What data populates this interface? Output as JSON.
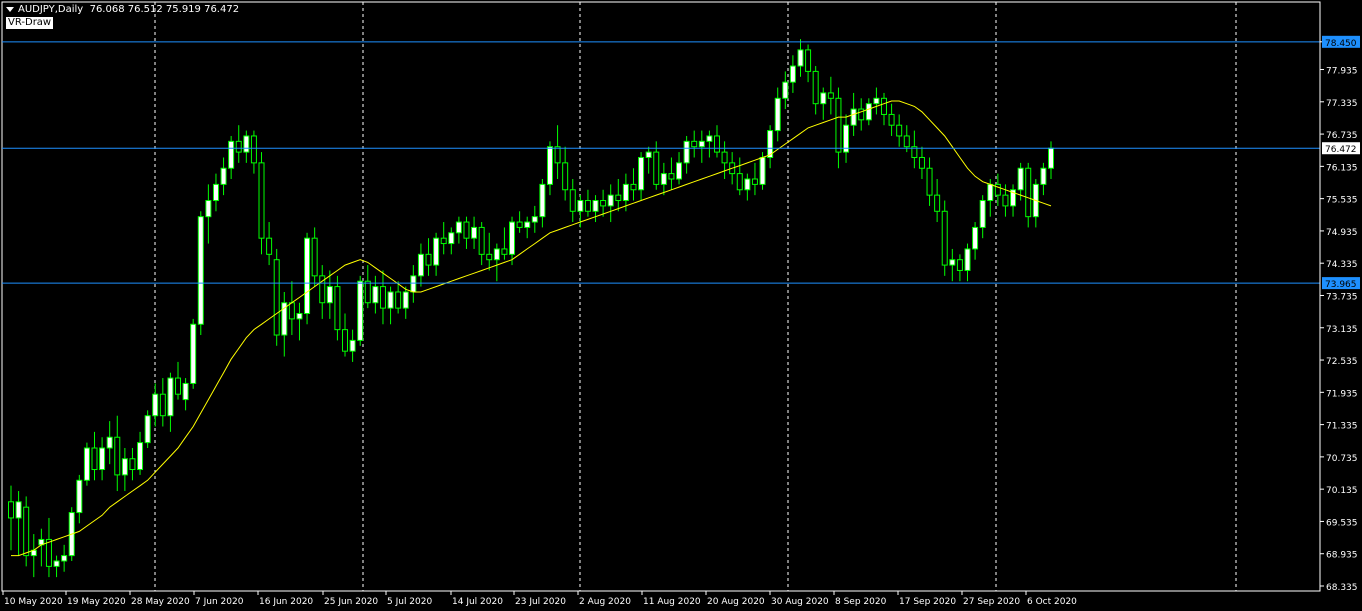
{
  "header": {
    "symbol_timeframe": "AUDJPY,Daily",
    "ohlc": "76.068 76.512 75.919 76.472",
    "indicator_label": "VR-Draw"
  },
  "colors": {
    "background": "#000000",
    "bull_candle": "#ffffff",
    "bear_candle": "#000000",
    "candle_outline": "#00ff00",
    "ma_line": "#ffff00",
    "hline": "#1e90ff",
    "price_tag": "#1e90ff",
    "current_price_tag": "#ffffff",
    "grid_vline": "#ffffff",
    "axis_text": "#ffffff"
  },
  "chart_data": {
    "type": "candlestick",
    "y_ticks": [
      "78.450",
      "77.935",
      "77.335",
      "76.735",
      "76.135",
      "75.535",
      "74.935",
      "74.335",
      "73.735",
      "73.135",
      "72.535",
      "71.935",
      "71.335",
      "70.735",
      "70.135",
      "69.535",
      "68.935",
      "68.335"
    ],
    "ylim": [
      68.335,
      78.85
    ],
    "x_tick_labels": [
      "10 May 2020",
      "19 May 2020",
      "28 May 2020",
      "7 Jun 2020",
      "16 Jun 2020",
      "25 Jun 2020",
      "5 Jul 2020",
      "14 Jul 2020",
      "23 Jul 2020",
      "2 Aug 2020",
      "11 Aug 2020",
      "20 Aug 2020",
      "30 Aug 2020",
      "8 Sep 2020",
      "17 Sep 2020",
      "27 Sep 2020",
      "6 Oct 2020"
    ],
    "period_separators": [
      "1 Jun 2020",
      "1 Jul 2020",
      "1 Aug 2020",
      "1 Sep 2020",
      "1 Oct 2020",
      "1 Nov 2020"
    ],
    "horizontal_lines": [
      {
        "price": 78.45,
        "label": "78.450"
      },
      {
        "price": 76.472,
        "label": "76.472",
        "current": true
      },
      {
        "price": 73.965,
        "label": "73.965"
      }
    ],
    "ohlc": [
      [
        69.9,
        70.2,
        69.0,
        69.6
      ],
      [
        69.6,
        70.1,
        68.9,
        69.9
      ],
      [
        69.8,
        70.0,
        68.7,
        68.9
      ],
      [
        68.9,
        69.3,
        68.5,
        69.0
      ],
      [
        69.1,
        69.4,
        68.7,
        69.2
      ],
      [
        69.2,
        69.6,
        68.5,
        68.7
      ],
      [
        68.7,
        68.9,
        68.5,
        68.8
      ],
      [
        68.8,
        69.1,
        68.6,
        68.9
      ],
      [
        68.9,
        69.8,
        68.8,
        69.7
      ],
      [
        69.7,
        70.4,
        69.5,
        70.3
      ],
      [
        70.3,
        71.0,
        70.2,
        70.9
      ],
      [
        70.9,
        71.2,
        70.3,
        70.5
      ],
      [
        70.5,
        71.1,
        70.3,
        70.9
      ],
      [
        70.9,
        71.4,
        70.6,
        71.1
      ],
      [
        71.1,
        71.5,
        70.1,
        70.4
      ],
      [
        70.4,
        70.9,
        70.1,
        70.7
      ],
      [
        70.7,
        70.9,
        70.3,
        70.5
      ],
      [
        70.5,
        71.2,
        70.4,
        71.0
      ],
      [
        71.0,
        71.6,
        70.9,
        71.5
      ],
      [
        71.5,
        72.1,
        71.3,
        71.9
      ],
      [
        71.9,
        72.2,
        71.3,
        71.5
      ],
      [
        71.5,
        72.3,
        71.2,
        72.2
      ],
      [
        72.2,
        72.5,
        71.8,
        71.9
      ],
      [
        71.8,
        72.2,
        71.6,
        72.1
      ],
      [
        72.1,
        73.3,
        72.0,
        73.2
      ],
      [
        73.2,
        75.3,
        73.0,
        75.2
      ],
      [
        75.2,
        75.8,
        74.7,
        75.5
      ],
      [
        75.5,
        76.0,
        75.3,
        75.8
      ],
      [
        75.8,
        76.3,
        75.6,
        76.1
      ],
      [
        76.1,
        76.7,
        75.9,
        76.6
      ],
      [
        76.6,
        76.9,
        76.2,
        76.4
      ],
      [
        76.4,
        76.8,
        76.2,
        76.7
      ],
      [
        76.7,
        76.8,
        76.0,
        76.2
      ],
      [
        76.2,
        76.4,
        74.5,
        74.8
      ],
      [
        74.8,
        75.1,
        74.3,
        74.5
      ],
      [
        74.4,
        74.6,
        72.8,
        73.0
      ],
      [
        73.0,
        73.8,
        72.6,
        73.6
      ],
      [
        73.6,
        74.0,
        73.0,
        73.3
      ],
      [
        73.3,
        73.6,
        72.9,
        73.4
      ],
      [
        73.4,
        74.9,
        73.2,
        74.8
      ],
      [
        74.8,
        75.0,
        73.9,
        74.1
      ],
      [
        74.1,
        74.3,
        73.3,
        73.6
      ],
      [
        73.6,
        74.2,
        73.3,
        73.9
      ],
      [
        73.9,
        74.1,
        72.9,
        73.1
      ],
      [
        73.1,
        73.4,
        72.6,
        72.7
      ],
      [
        72.7,
        73.1,
        72.5,
        72.9
      ],
      [
        72.9,
        74.1,
        72.8,
        74.0
      ],
      [
        74.0,
        74.3,
        73.5,
        73.6
      ],
      [
        73.6,
        74.1,
        73.4,
        73.9
      ],
      [
        73.9,
        74.2,
        73.2,
        73.5
      ],
      [
        73.5,
        73.9,
        73.2,
        73.8
      ],
      [
        73.8,
        74.0,
        73.4,
        73.5
      ],
      [
        73.5,
        73.9,
        73.3,
        73.8
      ],
      [
        73.8,
        74.3,
        73.6,
        74.1
      ],
      [
        74.1,
        74.7,
        73.9,
        74.5
      ],
      [
        74.5,
        74.8,
        74.1,
        74.3
      ],
      [
        74.3,
        74.9,
        74.1,
        74.8
      ],
      [
        74.8,
        75.1,
        74.5,
        74.7
      ],
      [
        74.7,
        75.0,
        74.5,
        74.9
      ],
      [
        74.9,
        75.2,
        74.7,
        75.1
      ],
      [
        75.1,
        75.2,
        74.6,
        74.8
      ],
      [
        74.8,
        75.2,
        74.6,
        75.0
      ],
      [
        75.0,
        75.1,
        74.3,
        74.5
      ],
      [
        74.5,
        74.9,
        74.2,
        74.4
      ],
      [
        74.4,
        74.7,
        74.0,
        74.6
      ],
      [
        74.6,
        75.0,
        74.4,
        74.5
      ],
      [
        74.5,
        75.2,
        74.3,
        75.1
      ],
      [
        75.1,
        75.3,
        74.9,
        75.0
      ],
      [
        75.0,
        75.2,
        74.8,
        75.1
      ],
      [
        75.1,
        75.4,
        74.9,
        75.2
      ],
      [
        75.2,
        75.9,
        75.0,
        75.8
      ],
      [
        75.8,
        76.6,
        75.6,
        76.5
      ],
      [
        76.5,
        76.9,
        75.9,
        76.2
      ],
      [
        76.2,
        76.5,
        75.5,
        75.7
      ],
      [
        75.7,
        75.9,
        75.1,
        75.3
      ],
      [
        75.3,
        75.6,
        75.0,
        75.5
      ],
      [
        75.5,
        75.7,
        75.2,
        75.3
      ],
      [
        75.3,
        75.6,
        75.1,
        75.5
      ],
      [
        75.5,
        75.7,
        75.2,
        75.4
      ],
      [
        75.4,
        75.8,
        75.1,
        75.6
      ],
      [
        75.6,
        75.9,
        75.3,
        75.5
      ],
      [
        75.5,
        76.0,
        75.3,
        75.8
      ],
      [
        75.8,
        76.1,
        75.5,
        75.7
      ],
      [
        75.7,
        76.4,
        75.5,
        76.3
      ],
      [
        76.3,
        76.5,
        76.0,
        76.4
      ],
      [
        76.4,
        76.6,
        75.7,
        75.8
      ],
      [
        75.8,
        76.2,
        75.6,
        76.0
      ],
      [
        76.0,
        76.3,
        75.7,
        75.9
      ],
      [
        75.9,
        76.4,
        75.8,
        76.2
      ],
      [
        76.2,
        76.7,
        76.0,
        76.6
      ],
      [
        76.6,
        76.8,
        76.3,
        76.5
      ],
      [
        76.5,
        76.8,
        76.2,
        76.6
      ],
      [
        76.6,
        76.8,
        76.3,
        76.7
      ],
      [
        76.7,
        76.9,
        76.3,
        76.4
      ],
      [
        76.4,
        76.6,
        75.9,
        76.2
      ],
      [
        76.2,
        76.4,
        75.8,
        76.0
      ],
      [
        76.0,
        76.3,
        75.6,
        75.7
      ],
      [
        75.7,
        76.0,
        75.5,
        75.9
      ],
      [
        75.9,
        76.2,
        75.6,
        75.8
      ],
      [
        75.8,
        76.4,
        75.7,
        76.3
      ],
      [
        76.3,
        76.9,
        76.1,
        76.8
      ],
      [
        76.8,
        77.6,
        76.6,
        77.4
      ],
      [
        77.4,
        77.9,
        77.2,
        77.7
      ],
      [
        77.7,
        78.2,
        77.5,
        78.0
      ],
      [
        78.0,
        78.5,
        77.8,
        78.3
      ],
      [
        78.3,
        78.4,
        77.7,
        77.9
      ],
      [
        77.9,
        78.0,
        77.1,
        77.3
      ],
      [
        77.3,
        77.6,
        77.0,
        77.5
      ],
      [
        77.5,
        77.8,
        77.1,
        77.4
      ],
      [
        77.4,
        77.6,
        76.1,
        76.4
      ],
      [
        76.4,
        77.1,
        76.2,
        76.9
      ],
      [
        76.9,
        77.5,
        76.7,
        77.2
      ],
      [
        77.2,
        77.4,
        76.8,
        77.0
      ],
      [
        77.0,
        77.4,
        76.9,
        77.3
      ],
      [
        77.3,
        77.6,
        77.1,
        77.4
      ],
      [
        77.4,
        77.5,
        76.9,
        77.1
      ],
      [
        77.1,
        77.3,
        76.7,
        76.9
      ],
      [
        76.9,
        77.1,
        76.5,
        76.7
      ],
      [
        76.7,
        76.9,
        76.4,
        76.5
      ],
      [
        76.5,
        76.8,
        76.1,
        76.3
      ],
      [
        76.3,
        76.5,
        75.9,
        76.1
      ],
      [
        76.1,
        76.3,
        75.4,
        75.6
      ],
      [
        75.6,
        75.9,
        75.1,
        75.3
      ],
      [
        75.3,
        75.5,
        74.1,
        74.3
      ],
      [
        74.3,
        74.6,
        74.0,
        74.4
      ],
      [
        74.4,
        74.5,
        74.0,
        74.2
      ],
      [
        74.2,
        74.7,
        74.0,
        74.6
      ],
      [
        74.6,
        75.1,
        74.4,
        75.0
      ],
      [
        75.0,
        75.6,
        74.8,
        75.5
      ],
      [
        75.5,
        75.9,
        75.2,
        75.8
      ],
      [
        75.8,
        76.0,
        75.4,
        75.6
      ],
      [
        75.6,
        75.8,
        75.2,
        75.4
      ],
      [
        75.4,
        75.8,
        75.2,
        75.7
      ],
      [
        75.7,
        76.2,
        75.5,
        76.1
      ],
      [
        76.1,
        76.2,
        75.0,
        75.2
      ],
      [
        75.2,
        75.9,
        75.0,
        75.8
      ],
      [
        75.8,
        76.2,
        75.6,
        76.1
      ],
      [
        76.1,
        76.6,
        75.9,
        76.472
      ]
    ],
    "ma": [
      68.9,
      68.9,
      68.95,
      69.0,
      69.1,
      69.15,
      69.2,
      69.25,
      69.3,
      69.35,
      69.45,
      69.55,
      69.65,
      69.8,
      69.9,
      70.0,
      70.1,
      70.2,
      70.3,
      70.45,
      70.6,
      70.75,
      70.9,
      71.1,
      71.3,
      71.55,
      71.8,
      72.05,
      72.3,
      72.55,
      72.75,
      72.95,
      73.1,
      73.2,
      73.3,
      73.4,
      73.5,
      73.6,
      73.7,
      73.8,
      73.9,
      74.0,
      74.1,
      74.2,
      74.3,
      74.35,
      74.4,
      74.35,
      74.25,
      74.15,
      74.05,
      73.95,
      73.85,
      73.8,
      73.8,
      73.85,
      73.9,
      73.95,
      74.0,
      74.05,
      74.1,
      74.15,
      74.2,
      74.25,
      74.3,
      74.35,
      74.4,
      74.5,
      74.6,
      74.7,
      74.8,
      74.9,
      74.95,
      75.0,
      75.05,
      75.1,
      75.15,
      75.2,
      75.25,
      75.3,
      75.35,
      75.4,
      75.45,
      75.5,
      75.55,
      75.6,
      75.65,
      75.7,
      75.75,
      75.8,
      75.85,
      75.9,
      75.95,
      76.0,
      76.05,
      76.1,
      76.15,
      76.2,
      76.25,
      76.3,
      76.35,
      76.45,
      76.55,
      76.65,
      76.75,
      76.85,
      76.9,
      76.95,
      77.0,
      77.05,
      77.05,
      77.1,
      77.15,
      77.2,
      77.25,
      77.3,
      77.35,
      77.35,
      77.3,
      77.25,
      77.15,
      77.0,
      76.85,
      76.7,
      76.5,
      76.3,
      76.1,
      75.95,
      75.85,
      75.8,
      75.75,
      75.7,
      75.65,
      75.6,
      75.55,
      75.5,
      75.45,
      75.4
    ]
  },
  "price_scale_labels": [
    "78.450",
    "77.935",
    "77.335",
    "76.735",
    "76.472",
    "76.135",
    "75.535",
    "74.935",
    "74.335",
    "73.965",
    "73.735",
    "73.135",
    "72.535",
    "71.935",
    "71.335",
    "70.735",
    "70.135",
    "69.535",
    "68.935",
    "68.335"
  ],
  "time_scale_labels": [
    "10 May 2020",
    "19 May 2020",
    "28 May 2020",
    "7 Jun 2020",
    "16 Jun 2020",
    "25 Jun 2020",
    "5 Jul 2020",
    "14 Jul 2020",
    "23 Jul 2020",
    "2 Aug 2020",
    "11 Aug 2020",
    "20 Aug 2020",
    "30 Aug 2020",
    "8 Sep 2020",
    "17 Sep 2020",
    "27 Sep 2020",
    "6 Oct 2020"
  ]
}
